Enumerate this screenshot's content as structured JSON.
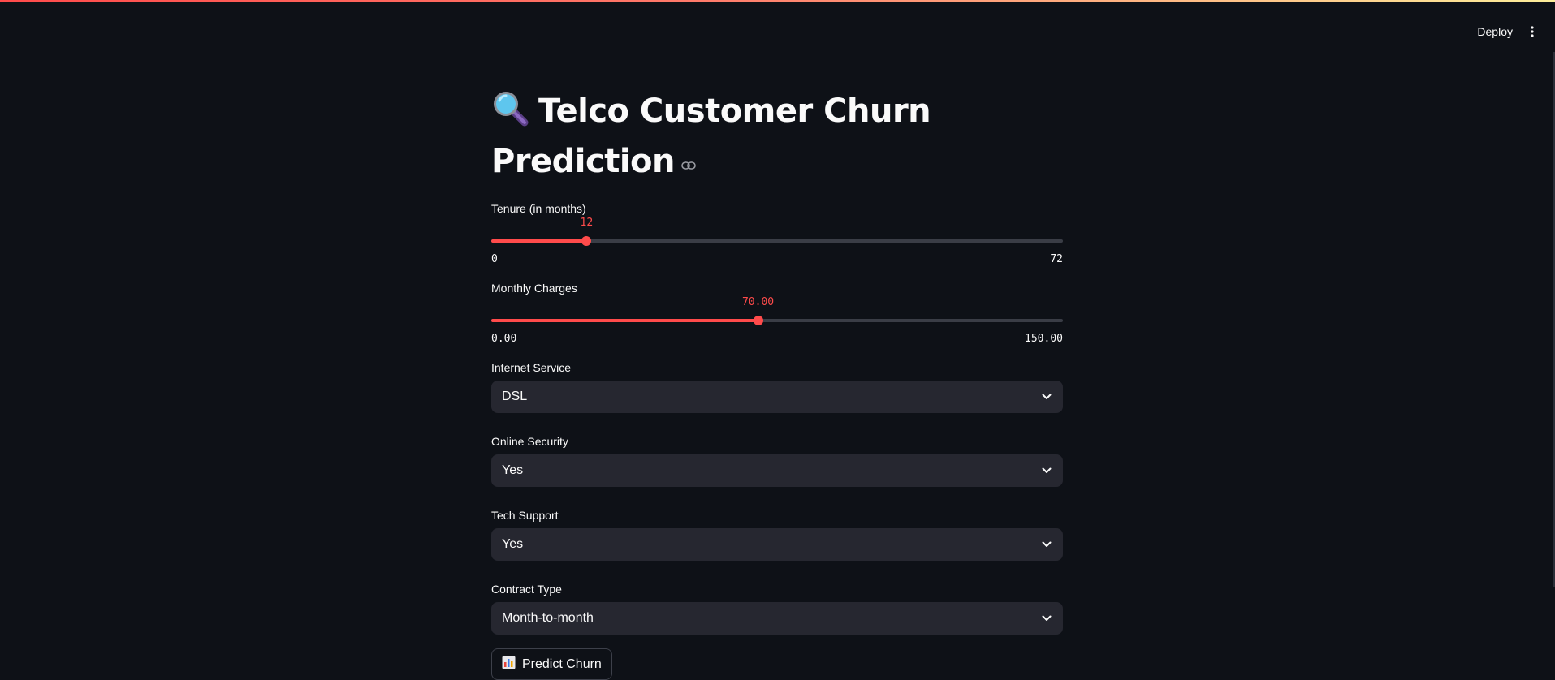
{
  "header": {
    "deploy_label": "Deploy",
    "menu_icon": "more-vertical-icon"
  },
  "page": {
    "title_icon": "magnifying-glass-icon",
    "title": "Telco Customer Churn Prediction",
    "anchor_icon": "link-icon"
  },
  "sliders": {
    "tenure": {
      "label": "Tenure (in months)",
      "value": "12",
      "min": "0",
      "max": "72",
      "fraction": 0.1667
    },
    "monthly_charges": {
      "label": "Monthly Charges",
      "value": "70.00",
      "min": "0.00",
      "max": "150.00",
      "fraction": 0.4667
    }
  },
  "selects": {
    "internet_service": {
      "label": "Internet Service",
      "value": "DSL"
    },
    "online_security": {
      "label": "Online Security",
      "value": "Yes"
    },
    "tech_support": {
      "label": "Tech Support",
      "value": "Yes"
    },
    "contract_type": {
      "label": "Contract Type",
      "value": "Month-to-month"
    }
  },
  "actions": {
    "predict_label": "Predict Churn",
    "predict_icon": "bar-chart-icon"
  },
  "colors": {
    "background": "#0e1117",
    "accent": "#ff4b4b",
    "input_bg": "#262730",
    "text": "#fafafa"
  }
}
